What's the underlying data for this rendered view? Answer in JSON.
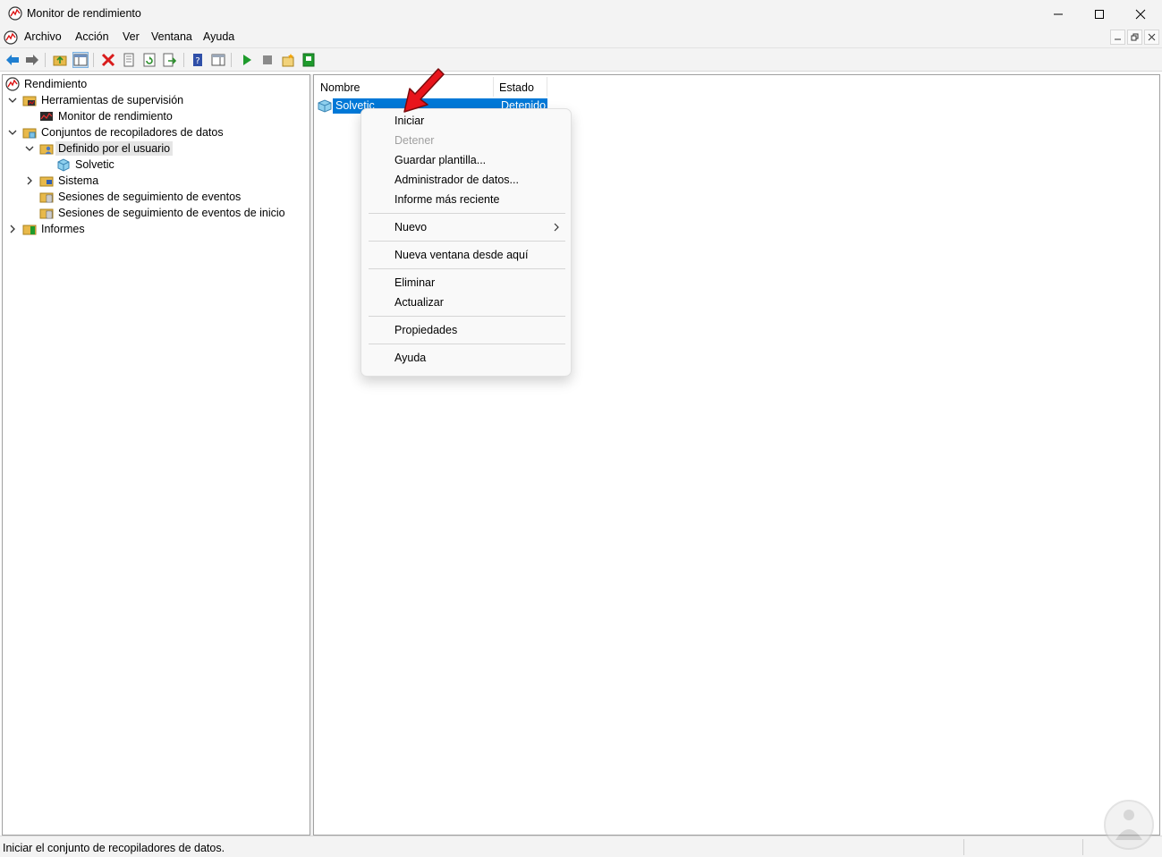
{
  "window": {
    "title": "Monitor de rendimiento"
  },
  "menu": {
    "items": [
      "Archivo",
      "Acción",
      "Ver",
      "Ventana",
      "Ayuda"
    ]
  },
  "tree": {
    "items": [
      {
        "label": "Rendimiento"
      },
      {
        "label": "Herramientas de supervisión"
      },
      {
        "label": "Monitor de rendimiento"
      },
      {
        "label": "Conjuntos de recopiladores de datos"
      },
      {
        "label": "Definido por el usuario"
      },
      {
        "label": "Solvetic"
      },
      {
        "label": "Sistema"
      },
      {
        "label": "Sesiones de seguimiento de eventos"
      },
      {
        "label": "Sesiones de seguimiento de eventos de inicio"
      },
      {
        "label": "Informes"
      }
    ]
  },
  "list": {
    "columns": [
      "Nombre",
      "Estado"
    ],
    "rows": [
      {
        "name": "Solvetic",
        "state": "Detenido"
      }
    ]
  },
  "context_menu": {
    "items": [
      {
        "label": "Iniciar"
      },
      {
        "label": "Detener"
      },
      {
        "label": "Guardar plantilla..."
      },
      {
        "label": "Administrador de datos..."
      },
      {
        "label": "Informe más reciente"
      },
      {
        "label": "Nuevo"
      },
      {
        "label": "Nueva ventana desde aquí"
      },
      {
        "label": "Eliminar"
      },
      {
        "label": "Actualizar"
      },
      {
        "label": "Propiedades"
      },
      {
        "label": "Ayuda"
      }
    ]
  },
  "status": {
    "text": "Iniciar el conjunto de recopiladores de datos."
  },
  "colors": {
    "selection": "#0078d7",
    "pointer_arrow": "#e8141b"
  }
}
